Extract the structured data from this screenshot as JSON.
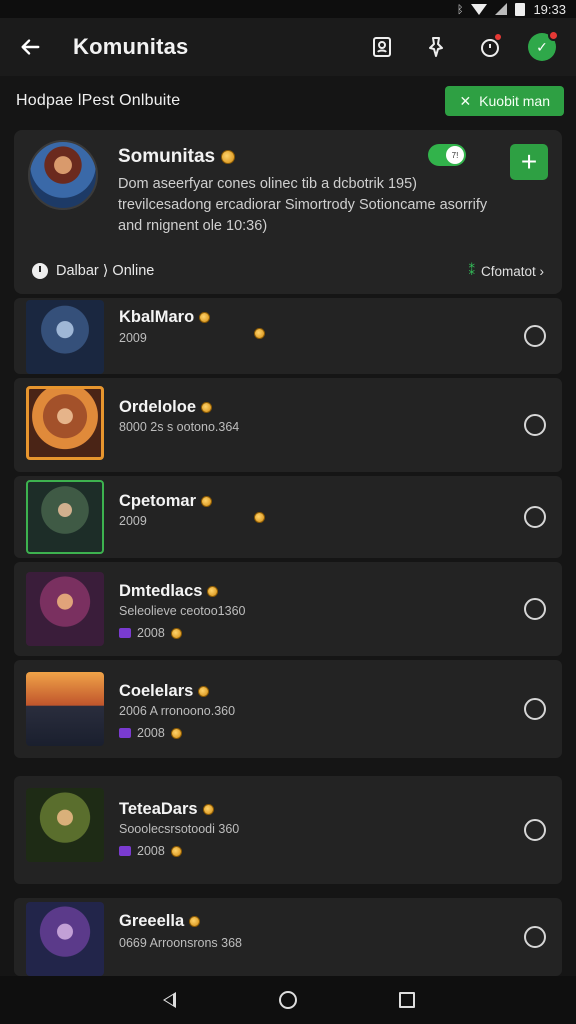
{
  "status_bar": {
    "time": "19:33"
  },
  "app_bar": {
    "title": "Komunitas",
    "actions": [
      "contacts-icon",
      "pin-icon",
      "timer-icon",
      "profile-avatar-icon"
    ]
  },
  "section": {
    "title": "Hodpae lPest Onlbuite",
    "chip_label": "Kuobit man"
  },
  "community": {
    "name": "Somunitas",
    "description": "Dom aseerfyar cones olinec tib a dcbotrik 195) trevilcesadong ercadiorar Simortrody Sotioncame asorrify and rnignent ole 10:36)",
    "status": "Dalbar ⟩ Online",
    "link": "Cfomatot ›",
    "toggle_on": true,
    "toggle_knob_text": "7!"
  },
  "members": [
    {
      "name": "KbalMaro",
      "sub": "2009",
      "sub2": "",
      "theme": "blue-knight"
    },
    {
      "name": "Ordeloloe",
      "sub": "8000 2s s ootono.364",
      "sub2": "",
      "theme": "orange-warrior"
    },
    {
      "name": "Cpetomar",
      "sub": "2009",
      "sub2": "",
      "theme": "green-hood"
    },
    {
      "name": "Dmtedlacs",
      "sub": "Seleolieve ceotoo1360",
      "sub2": "2008",
      "theme": "purple-mage"
    },
    {
      "name": "Coelelars",
      "sub": "2006 A rronoono.360",
      "sub2": "2008",
      "theme": "sunset-brute"
    },
    {
      "name": "TeteaDars",
      "sub": "Sooolecsrsotoodi 360",
      "sub2": "2008",
      "theme": "forest-paladin"
    },
    {
      "name": "Greeella",
      "sub": "0669 Arroonsrons 368",
      "sub2": "",
      "theme": "violet-sorceress"
    }
  ]
}
